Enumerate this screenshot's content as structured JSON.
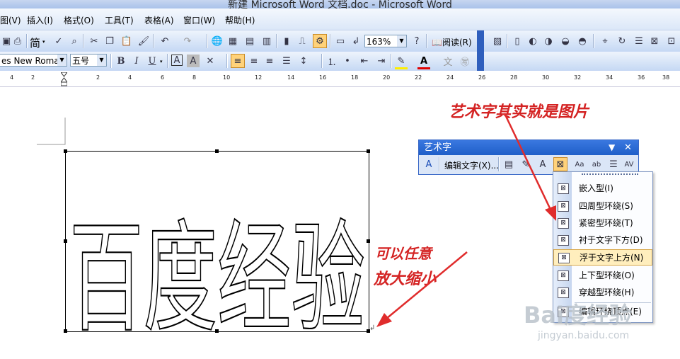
{
  "window": {
    "title": "新建 Microsoft Word 文档.doc - Microsoft Word"
  },
  "menu": {
    "items": [
      "图(V)",
      "插入(I)",
      "格式(O)",
      "工具(T)",
      "表格(A)",
      "窗口(W)",
      "帮助(H)"
    ]
  },
  "toolbar": {
    "chinese_convert": "简",
    "zoom": "163%",
    "read_label": "阅读(R)",
    "font_name": "es New Roman",
    "font_size": "五号",
    "bold": "B",
    "italic": "I",
    "underline": "U",
    "char_border": "A",
    "char_shade": "A"
  },
  "ruler": {
    "marks": [
      "4",
      "2",
      "2",
      "4",
      "6",
      "8",
      "10",
      "12",
      "14",
      "16",
      "18",
      "20",
      "22",
      "24",
      "26",
      "28",
      "30",
      "32",
      "34",
      "36",
      "38"
    ]
  },
  "wordart": {
    "text": "百度经验"
  },
  "wordart_toolbar": {
    "title": "艺术字",
    "edit_text_label": "编辑文字(X)...",
    "wrap_menu": [
      {
        "label": "嵌入型(I)",
        "active": false
      },
      {
        "label": "四周型环绕(S)",
        "active": false
      },
      {
        "label": "紧密型环绕(T)",
        "active": false
      },
      {
        "label": "衬于文字下方(D)",
        "active": false
      },
      {
        "label": "浮于文字上方(N)",
        "active": true
      },
      {
        "label": "上下型环绕(O)",
        "active": false
      },
      {
        "label": "穿越型环绕(H)",
        "active": false
      },
      {
        "label": "编辑环绕顶点(E)",
        "active": false
      }
    ]
  },
  "annotations": {
    "top": "艺术字其实就是图片",
    "middle_line1": "可以任意",
    "middle_line2": "放大缩小"
  },
  "watermark": {
    "logo": "Bai度经验",
    "url": "jingyan.baidu.com"
  },
  "colors": {
    "annotation": "#d42323",
    "title_bar": "#1f5fc8",
    "highlight": "#ffeebd"
  }
}
